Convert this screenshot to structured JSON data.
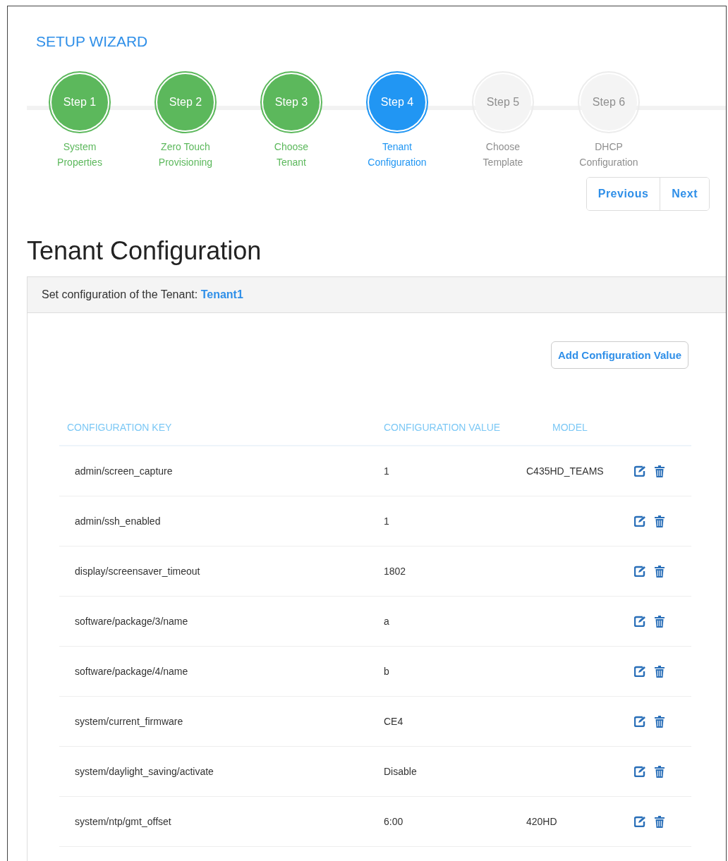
{
  "wizard": {
    "title": "SETUP WIZARD",
    "steps": [
      {
        "label": "Step 1",
        "caption": "System Properties",
        "completed": true,
        "selected": false
      },
      {
        "label": "Step 2",
        "caption": "Zero Touch Provisioning",
        "completed": true,
        "selected": false
      },
      {
        "label": "Step 3",
        "caption": "Choose Tenant",
        "completed": true,
        "selected": false
      },
      {
        "label": "Step 4",
        "caption": "Tenant Configuration",
        "completed": false,
        "selected": true
      },
      {
        "label": "Step 5",
        "caption": "Choose Template",
        "completed": false,
        "selected": false
      },
      {
        "label": "Step 6",
        "caption": "DHCP Configuration",
        "completed": false,
        "selected": false
      }
    ],
    "buttons": [
      "Previous",
      "Next"
    ]
  },
  "heading": "Tenant Configuration",
  "panel": {
    "header": "Set configuration of the Tenant: ",
    "tenant": "Tenant1",
    "add_button": "Add Configuration Value",
    "table": {
      "columns": [
        "CONFIGURATION KEY",
        "CONFIGURATION VALUE",
        "MODEL"
      ],
      "rows": [
        {
          "key": "admin/screen_capture",
          "value": "1",
          "model": "C435HD_TEAMS"
        },
        {
          "key": "admin/ssh_enabled",
          "value": "1",
          "model": ""
        },
        {
          "key": "display/screensaver_timeout",
          "value": "1802",
          "model": ""
        },
        {
          "key": "software/package/3/name",
          "value": "a",
          "model": ""
        },
        {
          "key": "software/package/4/name",
          "value": "b",
          "model": ""
        },
        {
          "key": "system/current_firmware",
          "value": "CE4",
          "model": ""
        },
        {
          "key": "system/daylight_saving/activate",
          "value": "Disable",
          "model": ""
        },
        {
          "key": "system/ntp/gmt_offset",
          "value": "6:00",
          "model": "420HD"
        }
      ]
    }
  }
}
